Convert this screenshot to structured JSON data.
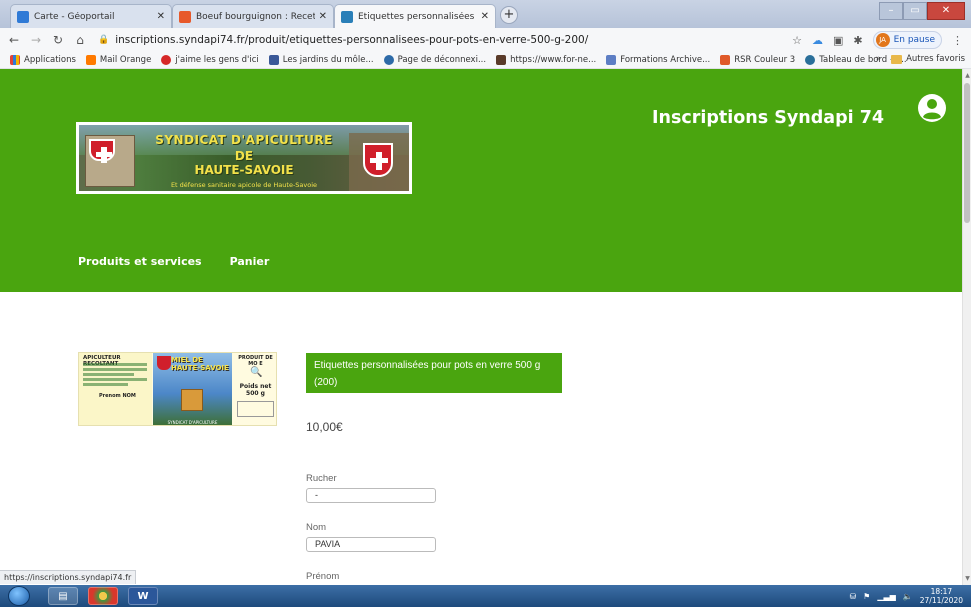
{
  "browser": {
    "tabs": [
      {
        "title": "Carte - Géoportail",
        "favicon_color": "#2f7ad6"
      },
      {
        "title": "Boeuf bourguignon : Recette de",
        "favicon_color": "#e7592b"
      },
      {
        "title": "Etiquettes personnalisées pour p",
        "favicon_color": "#2a7fb8"
      }
    ],
    "new_tab": "+",
    "url": "inscriptions.syndapi74.fr/produit/etiquettes-personnalisees-pour-pots-en-verre-500-g-200/",
    "profile_initials": "JA",
    "profile_status": "En pause",
    "bookmarks": [
      {
        "label": "Applications",
        "color": "#e0443b"
      },
      {
        "label": "Mail Orange",
        "color": "#ff7a00"
      },
      {
        "label": "j'aime les gens d'ici",
        "color": "#d62828"
      },
      {
        "label": "Les jardins du môle...",
        "color": "#3b5998"
      },
      {
        "label": "Page de déconnexi...",
        "color": "#2d6aa8"
      },
      {
        "label": "https://www.for-ne...",
        "color": "#5a3b2a"
      },
      {
        "label": "Formations Archive...",
        "color": "#5d7ec4"
      },
      {
        "label": "RSR Couleur 3",
        "color": "#e05a2a"
      },
      {
        "label": "Tableau de bord ‹ I...",
        "color": "#2a6f9a"
      }
    ],
    "bookmarks_more": "»",
    "other_bookmarks": "Autres favoris",
    "status_url": "https://inscriptions.syndapi74.fr"
  },
  "site": {
    "title": "Inscriptions Syndapi 74",
    "logo": {
      "line1": "SYNDICAT D'APICULTURE",
      "line2": "DE",
      "line3": "HAUTE-SAVOIE",
      "line4": "Et défense sanitaire apicole de Haute-Savoie"
    },
    "menu": [
      "Produits et services",
      "Panier"
    ],
    "brand_color": "#4aa50f"
  },
  "product": {
    "name": "Etiquettes personnalisées pour pots en verre 500 g (200)",
    "price": "10,00€",
    "image": {
      "panel1_title": "APICULTEUR RECOLTANT",
      "panel1_name": "Prenom NOM",
      "panel2_title": "MIEL DE HAUTE-SAVOIE",
      "panel2_footer": "SYNDICAT D'APICULTURE",
      "panel3_title": "PRODUIT DE MO E",
      "panel3_weight_label": "Poids net",
      "panel3_weight": "500 g"
    },
    "fields": [
      {
        "label": "Rucher",
        "value": "-"
      },
      {
        "label": "Nom",
        "value": "PAVIA"
      },
      {
        "label": "Prénom",
        "value": ""
      }
    ]
  },
  "taskbar": {
    "time": "18:17",
    "date": "27/11/2020"
  }
}
